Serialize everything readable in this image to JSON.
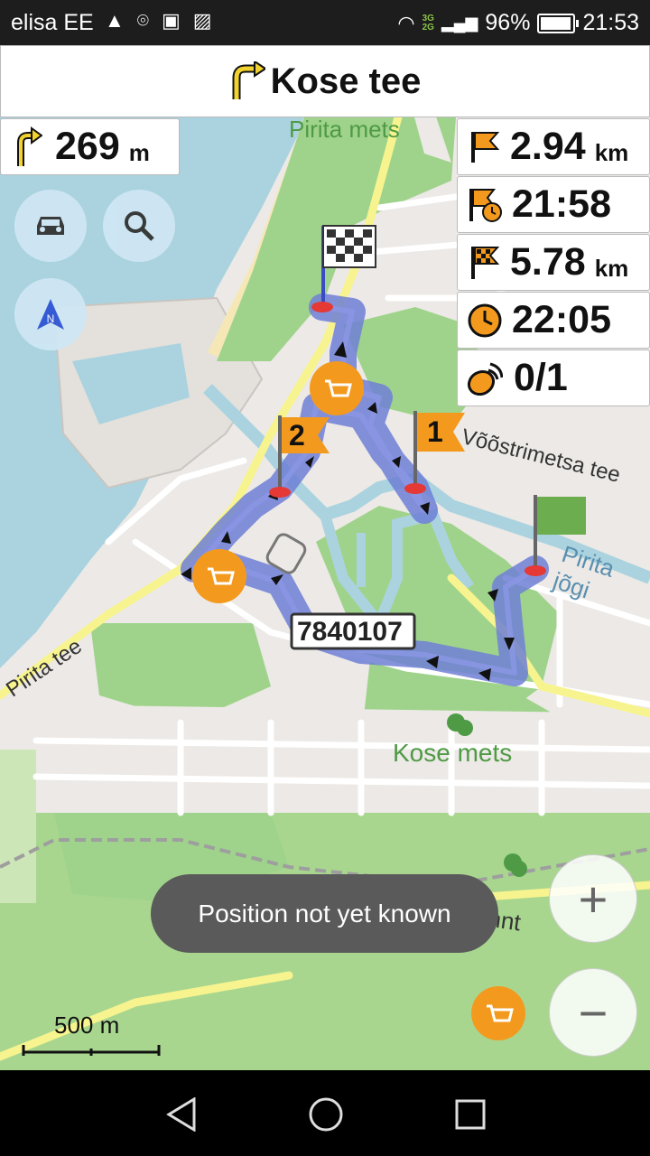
{
  "status_bar": {
    "carrier": "elisa EE",
    "network": [
      "3G",
      "2G"
    ],
    "battery": "96%",
    "battery_level": 0.96,
    "time": "21:53"
  },
  "instruction": {
    "street": "Kose tee",
    "icon": "turn-right-arrow-icon"
  },
  "next_turn": {
    "distance": "269",
    "unit": "m",
    "icon": "turn-right-arrow-icon"
  },
  "info_boxes": [
    {
      "icon": "flag-icon",
      "value": "2.94",
      "unit": "km"
    },
    {
      "icon": "flag-clock-icon",
      "value": "21:58",
      "unit": ""
    },
    {
      "icon": "checkered-flag-icon",
      "value": "5.78",
      "unit": "km"
    },
    {
      "icon": "clock-icon",
      "value": "22:05",
      "unit": ""
    },
    {
      "icon": "satellite-icon",
      "value": "0/1",
      "unit": ""
    }
  ],
  "map_labels": {
    "pirita_mets": "Pirita mets",
    "vooStrimetsa": "Võõstrimetsa tee",
    "pirita_jogi": "Pirita jõgi",
    "pirita_tee": "Pirita tee",
    "kose_mets": "Kose mets",
    "narva_mnt": "Narva mnt",
    "road_id": "7840107"
  },
  "waypoints": {
    "wp1": "1",
    "wp2": "2"
  },
  "toast": "Position not yet known",
  "scale": "500 m",
  "zoom": {
    "in": "+",
    "out": "−"
  },
  "colors": {
    "accent": "#f39a1e",
    "route": "#6f7fd6",
    "water": "#aad3df",
    "park": "#9fd38b"
  }
}
